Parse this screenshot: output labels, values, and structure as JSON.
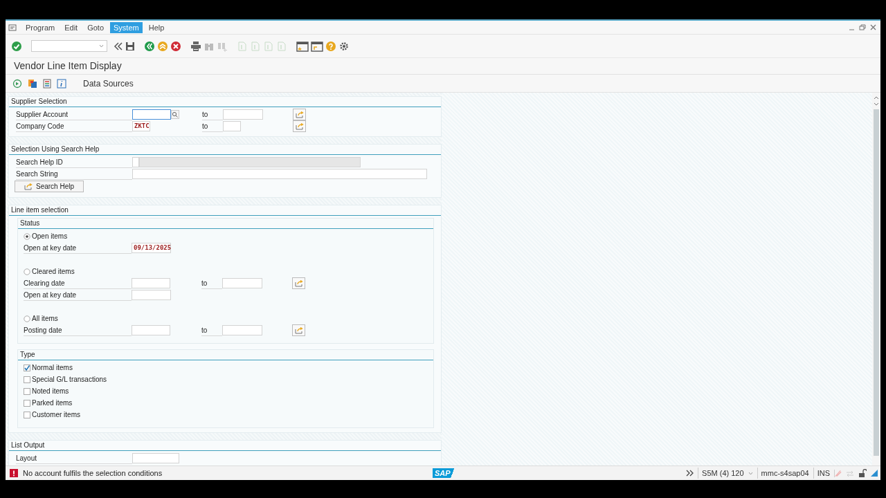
{
  "menu_bar": {
    "items": [
      {
        "label": "Program",
        "selected": false
      },
      {
        "label": "Edit",
        "selected": false
      },
      {
        "label": "Goto",
        "selected": false
      },
      {
        "label": "System",
        "selected": true
      },
      {
        "label": "Help",
        "selected": false
      }
    ]
  },
  "title": "Vendor Line Item Display",
  "app_toolbar": {
    "buttons": [
      "Data Sources"
    ]
  },
  "sections": [
    {
      "title": "Supplier Selection",
      "rows": [
        {
          "kind": "range",
          "label": "Supplier Account",
          "to_label": "to",
          "search_help": true,
          "focused": true
        },
        {
          "kind": "range_short",
          "label": "Company Code",
          "value": "ZKTC",
          "to_label": "to",
          "focused": false
        }
      ]
    },
    {
      "title": "Selection Using Search Help",
      "rows": [
        {
          "kind": "help_id",
          "label": "Search Help ID",
          "disabled": true
        },
        {
          "kind": "text",
          "label": "Search String"
        },
        {
          "kind": "button",
          "label": "Search Help"
        }
      ]
    },
    {
      "title": "Line item selection",
      "groups": [
        {
          "title": "Status",
          "rows": [
            {
              "kind": "radio",
              "label": "Open items",
              "selected": true
            },
            {
              "kind": "single",
              "label": "Open at key date",
              "value": "09/13/2025"
            },
            {
              "kind": "radio",
              "label": "Cleared items",
              "selected": false
            },
            {
              "kind": "range",
              "label": "Clearing date",
              "to_label": "to",
              "focused": false
            },
            {
              "kind": "single",
              "label": "Open at key date"
            },
            {
              "kind": "radio",
              "label": "All items",
              "selected": false
            },
            {
              "kind": "range",
              "label": "Posting date",
              "to_label": "to",
              "focused": false
            }
          ]
        },
        {
          "title": "Type",
          "rows": [
            {
              "kind": "checkbox",
              "label": "Normal items",
              "checked": true
            },
            {
              "kind": "checkbox",
              "label": "Special G/L transactions",
              "checked": false
            },
            {
              "kind": "checkbox",
              "label": "Noted items",
              "checked": false
            },
            {
              "kind": "checkbox",
              "label": "Parked items",
              "checked": false
            },
            {
              "kind": "checkbox",
              "label": "Customer items",
              "checked": false
            }
          ]
        }
      ]
    },
    {
      "title": "List Output",
      "rows": [
        {
          "kind": "wide_single",
          "label": "Layout"
        }
      ]
    }
  ],
  "status_bar": {
    "error": true,
    "message": "No account fulfils the selection conditions",
    "logo": "SAP",
    "system": "S5M (4) 120",
    "server": "mmc-s4sap04",
    "mode": "INS"
  }
}
